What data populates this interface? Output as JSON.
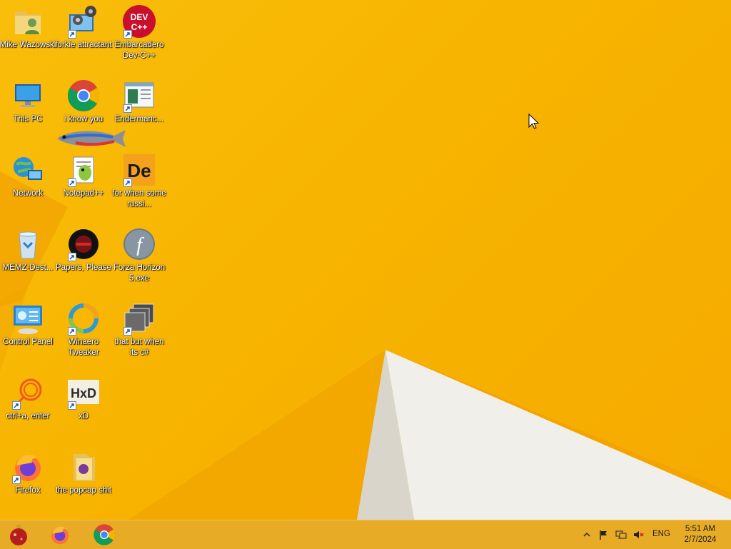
{
  "desktop": {
    "icons": {
      "mike": {
        "label": "Mike Wazowski"
      },
      "forkie": {
        "label": "forkie attractant"
      },
      "devcpp": {
        "label": "Embarcadero Dev-C++",
        "badge": "DEV\nC++"
      },
      "thispc": {
        "label": "This PC"
      },
      "chrome": {
        "label": "i know you"
      },
      "endermanch": {
        "label": "Endermanc..."
      },
      "network": {
        "label": "Network"
      },
      "notepadpp": {
        "label": "Notepad++"
      },
      "de": {
        "label": "for when some russi...",
        "badge": "De"
      },
      "memz": {
        "label": "MEMZ-Dest..."
      },
      "papers": {
        "label": "Papers, Please"
      },
      "forza": {
        "label": "Forza Horizon 5.exe",
        "badge": "f"
      },
      "controlpanel": {
        "label": "Control Panel"
      },
      "winaero": {
        "label": "Winaero Tweaker"
      },
      "csharp": {
        "label": "that but when its c#"
      },
      "ctrla": {
        "label": "ctrl+a, enter"
      },
      "xd": {
        "label": "xD",
        "badge": "HxD"
      },
      "firefox": {
        "label": "Firefox"
      },
      "popcap": {
        "label": "the popcap shit"
      }
    }
  },
  "taskbar": {
    "pinned": [
      "ornament-start",
      "firefox",
      "chrome"
    ],
    "tray": {
      "lang": "ENG",
      "time": "5:51 AM",
      "date": "2/7/2024"
    }
  },
  "colors": {
    "wallpaper": "#f7b400",
    "taskbar": "#e6aa28"
  }
}
